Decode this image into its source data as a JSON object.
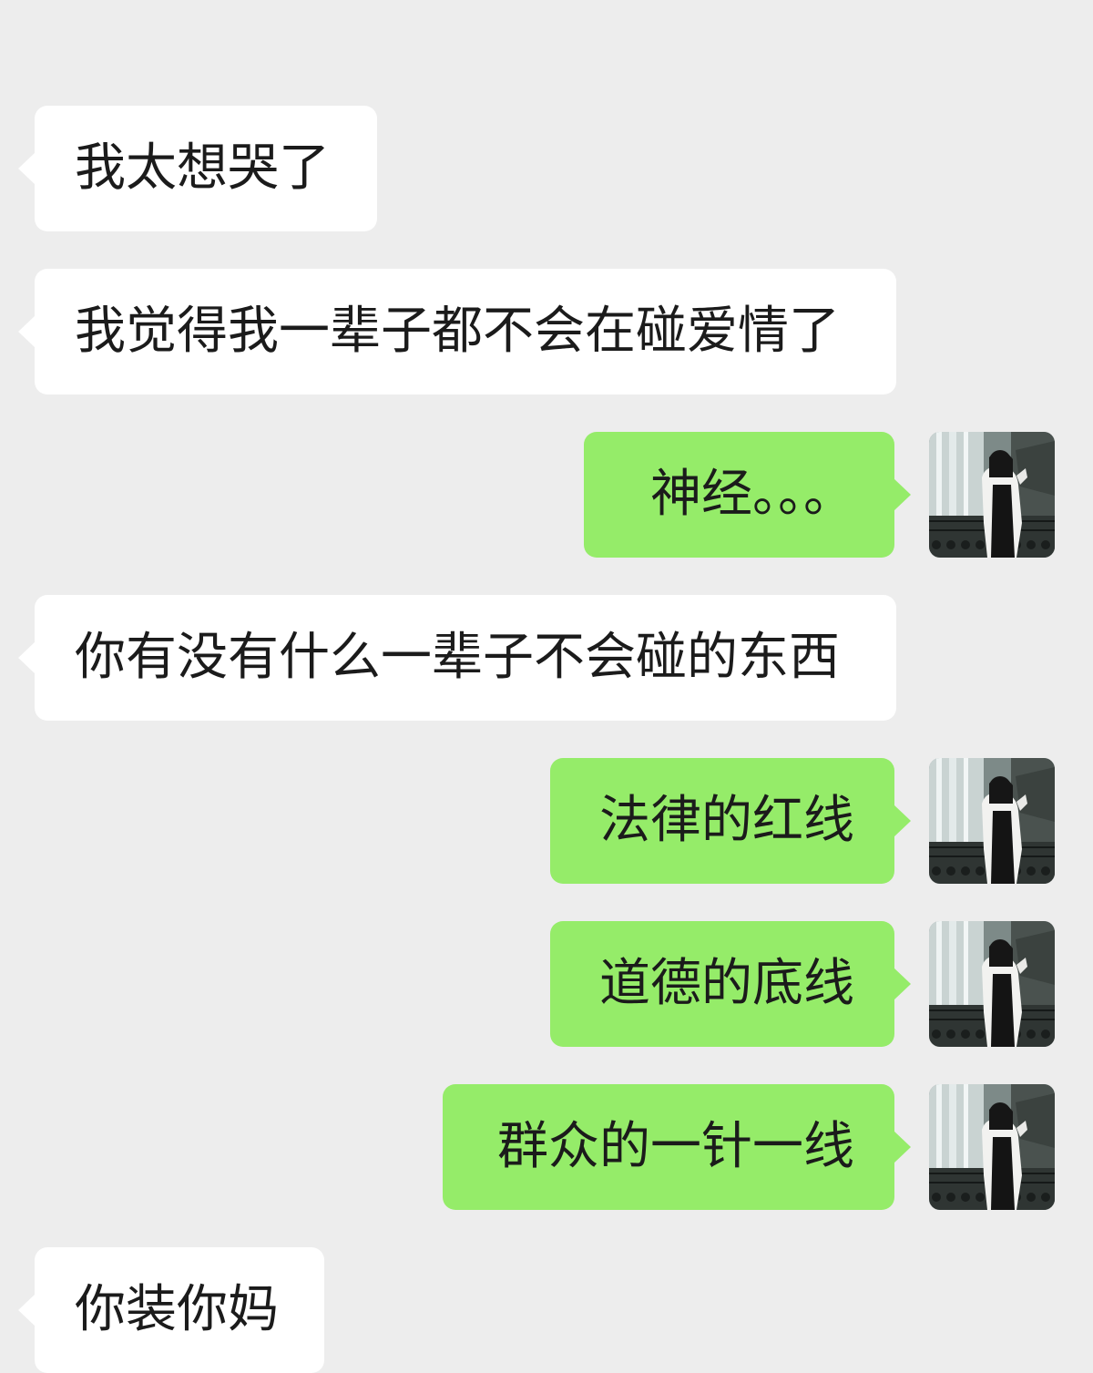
{
  "messages": [
    {
      "side": "in",
      "text": "我太想哭了"
    },
    {
      "side": "in",
      "text": "我觉得我一辈子都不会在碰爱情了"
    },
    {
      "side": "out",
      "text": "神经。。。",
      "avatar": "user-avatar-photo"
    },
    {
      "side": "in",
      "text": "你有没有什么一辈子不会碰的东西"
    },
    {
      "side": "out",
      "text": "法律的红线",
      "avatar": "user-avatar-photo"
    },
    {
      "side": "out",
      "text": "道德的底线",
      "avatar": "user-avatar-photo"
    },
    {
      "side": "out",
      "text": "群众的一针一线",
      "avatar": "user-avatar-photo"
    },
    {
      "side": "in",
      "text": "你装你妈"
    }
  ],
  "colors": {
    "background": "#ededed",
    "incoming_bubble": "#ffffff",
    "outgoing_bubble": "#95ec69",
    "text": "#1b1b1b"
  }
}
